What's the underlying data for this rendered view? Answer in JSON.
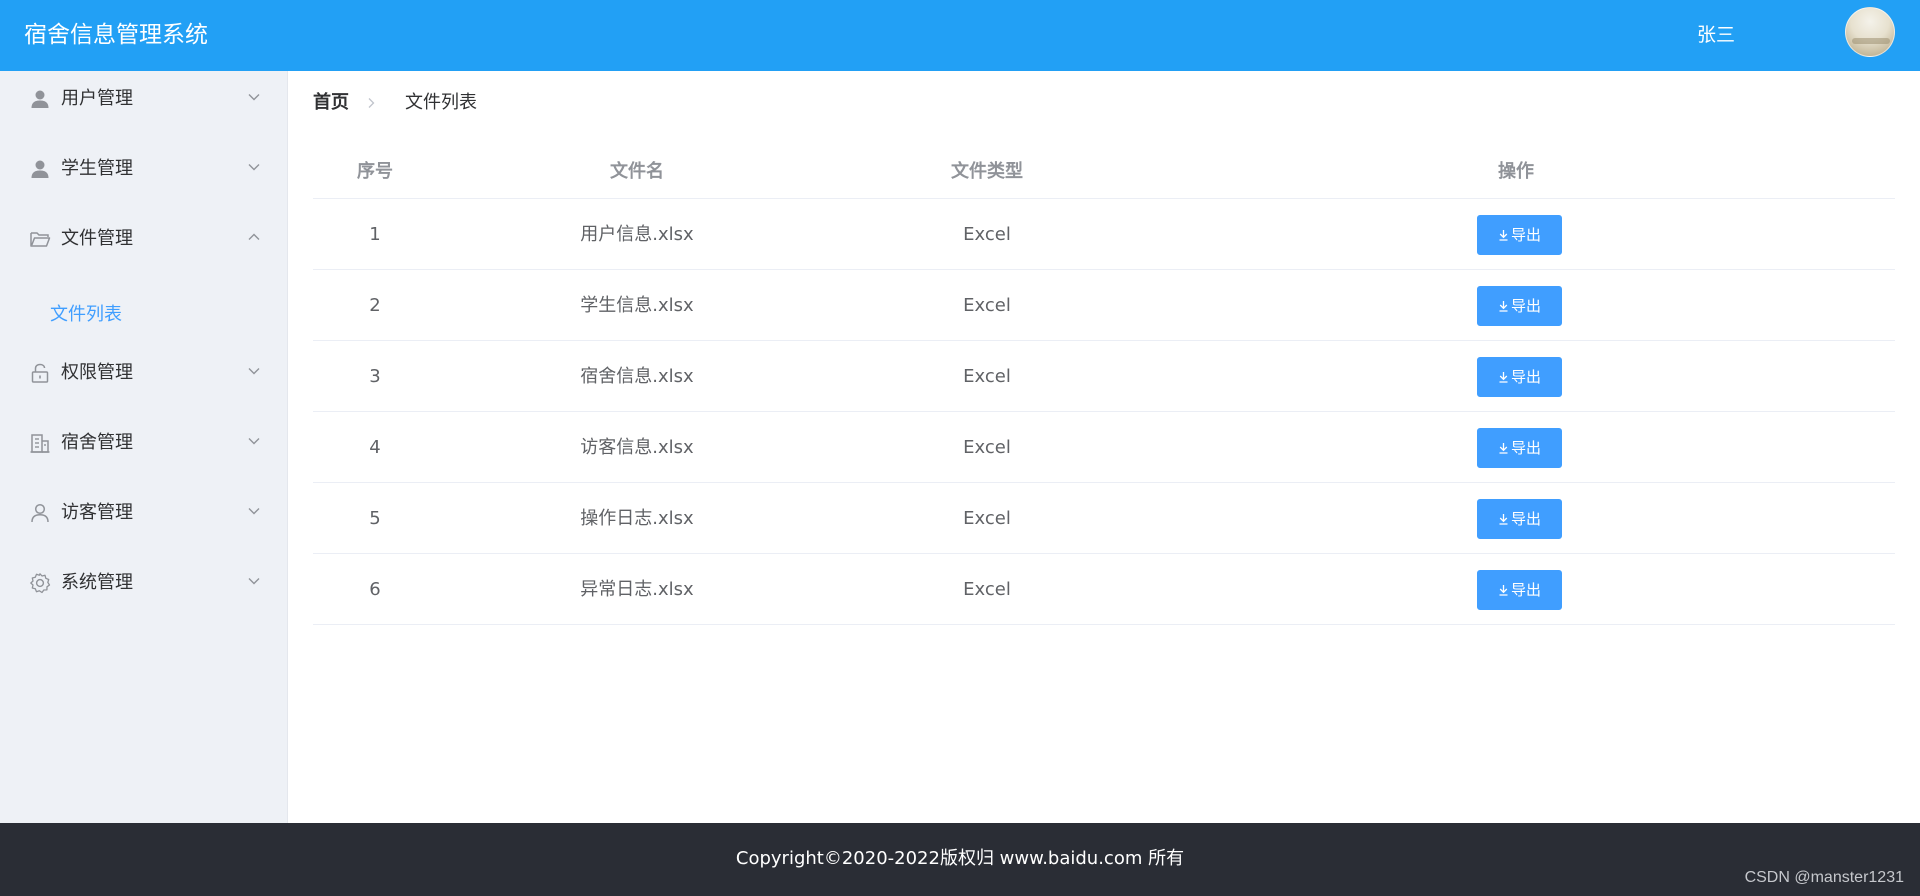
{
  "header": {
    "app_title": "宿舍信息管理系统",
    "user_name": "张三",
    "background_color": "#22a0f5"
  },
  "sidebar": {
    "items": [
      {
        "label": "用户管理",
        "icon": "user-solid-icon",
        "expanded": false
      },
      {
        "label": "学生管理",
        "icon": "user-solid-icon",
        "expanded": false
      },
      {
        "label": "文件管理",
        "icon": "folder-open-icon",
        "expanded": true,
        "children": [
          {
            "label": "文件列表",
            "active": true
          }
        ]
      },
      {
        "label": "权限管理",
        "icon": "lock-icon",
        "expanded": false
      },
      {
        "label": "宿舍管理",
        "icon": "office-building-icon",
        "expanded": false
      },
      {
        "label": "访客管理",
        "icon": "user-outline-icon",
        "expanded": false
      },
      {
        "label": "系统管理",
        "icon": "setting-icon",
        "expanded": false
      }
    ],
    "active_color": "#409eff"
  },
  "breadcrumb": {
    "home": "首页",
    "current": "文件列表"
  },
  "table": {
    "columns": [
      "序号",
      "文件名",
      "文件类型",
      "操作"
    ],
    "export_label": "导出",
    "rows": [
      {
        "index": "1",
        "name": "用户信息.xlsx",
        "type": "Excel"
      },
      {
        "index": "2",
        "name": "学生信息.xlsx",
        "type": "Excel"
      },
      {
        "index": "3",
        "name": "宿舍信息.xlsx",
        "type": "Excel"
      },
      {
        "index": "4",
        "name": "访客信息.xlsx",
        "type": "Excel"
      },
      {
        "index": "5",
        "name": "操作日志.xlsx",
        "type": "Excel"
      },
      {
        "index": "6",
        "name": "异常日志.xlsx",
        "type": "Excel"
      }
    ]
  },
  "footer": {
    "copyright": "Copyright©2020-2022版权归 www.baidu.com 所有",
    "watermark": "CSDN @manster1231"
  }
}
